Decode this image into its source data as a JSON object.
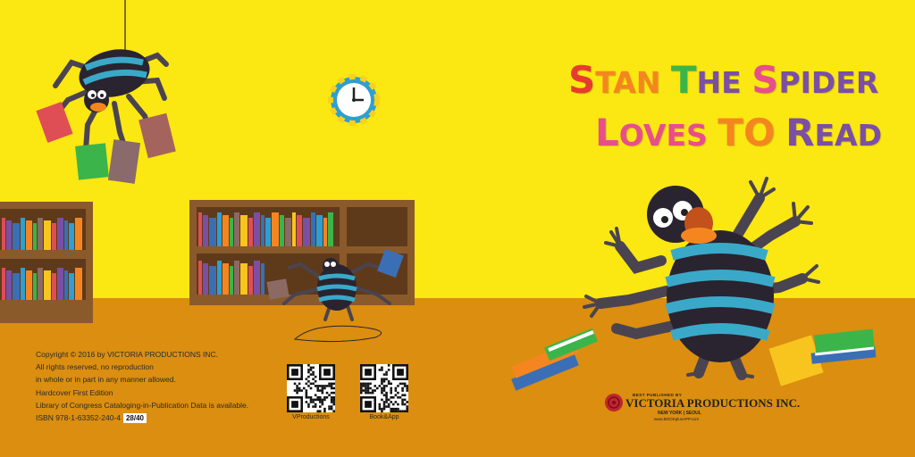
{
  "colors": {
    "wall": "#FBE712",
    "floor": "#DB8E0F",
    "shelf": "#8B5A2B",
    "spider_stripe_dark": "#2A2430",
    "spider_stripe_blue": "#3AA9C9",
    "spider_limbs": "#4A4450",
    "spider_face": "#C2511C",
    "title_pink": "#E84E8A",
    "title_green": "#3BB54A",
    "title_orange": "#F5861F",
    "title_purple": "#7B4FA3",
    "title_red": "#E63C2F"
  },
  "icons": [
    "hanging-spider-icon",
    "reading-spider-icon",
    "big-spider-icon",
    "clock-icon",
    "bookshelf-icon",
    "book-stack-icon",
    "qr-code-icon",
    "publisher-seal-icon"
  ],
  "title": {
    "line1": [
      {
        "text": "S",
        "color": "#E63C2F"
      },
      {
        "text": "TAN",
        "color": "#F5861F"
      },
      {
        "text": " ",
        "color": "#000"
      },
      {
        "text": "T",
        "color": "#3BB54A"
      },
      {
        "text": "HE",
        "color": "#7B4FA3"
      },
      {
        "text": " ",
        "color": "#000"
      },
      {
        "text": "S",
        "color": "#E84E8A"
      },
      {
        "text": "PIDER",
        "color": "#7B4FA3"
      }
    ],
    "line2": [
      {
        "text": "L",
        "color": "#E84E8A"
      },
      {
        "text": "OVES",
        "color": "#E84E8A"
      },
      {
        "text": " ",
        "color": "#000"
      },
      {
        "text": "T",
        "color": "#F5861F"
      },
      {
        "text": "O",
        "color": "#F5861F"
      },
      {
        "text": " ",
        "color": "#000"
      },
      {
        "text": "R",
        "color": "#7B4FA3"
      },
      {
        "text": "EAD",
        "color": "#7B4FA3"
      }
    ]
  },
  "copyright": {
    "line1": "Copyright © 2016 by VICTORIA PRODUCTIONS INC.",
    "line2": "All rights reserved, no reproduction",
    "line3": "in whole or in part in any manner allowed.",
    "line4": "Hardcover First Edition",
    "line5": "Library of Congress Cataloging-in-Publication Data is available.",
    "isbn": "ISBN 978-1-63352-240-4",
    "page": "28/40"
  },
  "qr_codes": [
    {
      "label": "VProductions"
    },
    {
      "label": "Book&App"
    }
  ],
  "publisher": {
    "tagline": "BEST PUBLISHED BY",
    "name": "VICTORIA PRODUCTIONS INC.",
    "cities": "NEW YORK | SEOUL",
    "url": "www.BOOKplusAPP.com"
  }
}
